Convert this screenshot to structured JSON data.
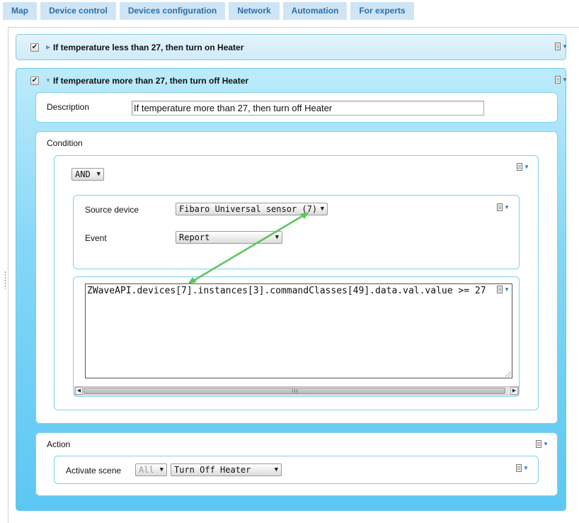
{
  "tabs": [
    "Map",
    "Device control",
    "Devices configuration",
    "Network",
    "Automation",
    "For experts"
  ],
  "rules": [
    {
      "enabled": true,
      "expanded": false,
      "title": "If temperature less than 27, then turn on Heater"
    },
    {
      "enabled": true,
      "expanded": true,
      "title": "If temperature more than 27, then turn off Heater"
    }
  ],
  "description": {
    "label": "Description",
    "value": "If temperature more than 27, then turn off Heater"
  },
  "condition": {
    "label": "Condition",
    "operator": "AND",
    "source_device_label": "Source device",
    "source_device_value": "Fibaro Universal sensor (7)",
    "event_label": "Event",
    "event_value": "Report",
    "expression": "ZWaveAPI.devices[7].instances[3].commandClasses[49].data.val.value >= 27"
  },
  "action": {
    "label": "Action",
    "activate_scene_label": "Activate scene",
    "scope_value": "All",
    "scene_value": "Turn Off Heater"
  },
  "icons": {
    "checkbox": "check-icon",
    "expand": "triangle-right-icon",
    "collapse": "triangle-down-icon",
    "menu": "menu-dropdown-icon",
    "dropdown": "caret-down-icon"
  },
  "colors": {
    "tab_bg": "#cfe4f5",
    "tab_text": "#2b6fa8",
    "rule_gradient_top": "#bdebfb",
    "rule_gradient_bottom": "#5cc7f3",
    "link_arrow": "#5cc45c"
  }
}
